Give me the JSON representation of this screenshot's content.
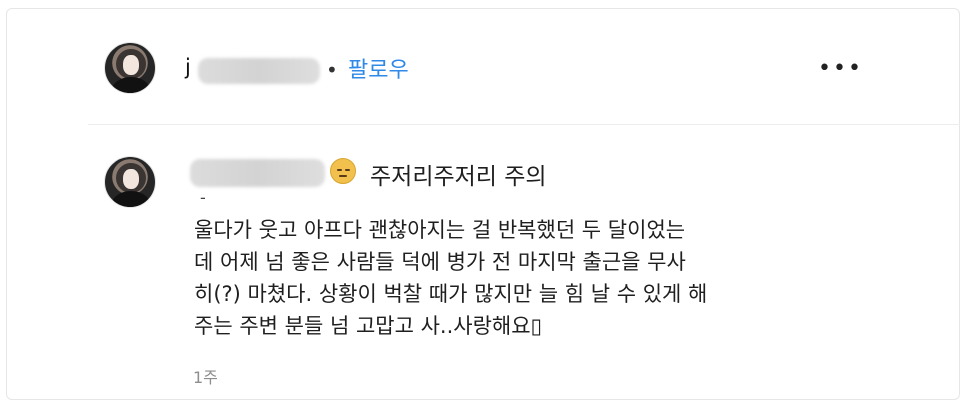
{
  "header": {
    "username_visible": "j",
    "separator": "•",
    "follow_label": "팔로우",
    "more_label": "•••"
  },
  "comment": {
    "caption": "주저리주저리 주의",
    "dash": "-",
    "lines": [
      "울다가 웃고 아프다 괜찮아지는 걸 반복했던 두 달이었는",
      "데 어제 넘 좋은 사람들 덕에 병가 전 마지막 출근을 무사",
      "히(?) 마쳤다. 상황이 벅찰 때가 많지만 늘 힘 날 수 있게 해",
      "주는 주변 분들 넘 고맙고 사..사랑해요▯"
    ],
    "time": "1주"
  },
  "icons": {
    "avatar": "profile-photo",
    "emoji": "pensive-face-emoji",
    "more": "more-options-icon"
  },
  "colors": {
    "follow": "#2f89e8",
    "time": "#8e8e8e"
  }
}
